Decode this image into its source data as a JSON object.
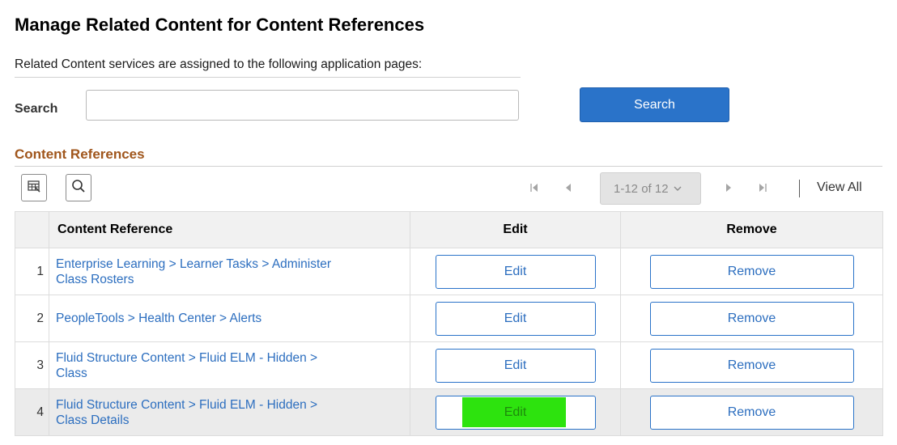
{
  "page": {
    "title": "Manage Related Content for Content References",
    "instruction": "Related Content services are assigned to the following application pages:"
  },
  "search": {
    "label": "Search",
    "value": "",
    "placeholder": "",
    "button_label": "Search"
  },
  "grid": {
    "section_title": "Content References",
    "toolbar": {
      "personalize_icon": "grid-personalize-icon",
      "find_icon": "search-icon"
    },
    "pager": {
      "range_label": "1-12 of 12",
      "view_all_label": "View All"
    },
    "columns": {
      "row_number": "",
      "content_reference": "Content Reference",
      "edit": "Edit",
      "remove": "Remove"
    },
    "rows": [
      {
        "number": "1",
        "content_reference_line1": "Enterprise Learning > Learner Tasks > Administer",
        "content_reference_line2": "Class Rosters",
        "edit_label": "Edit",
        "remove_label": "Remove"
      },
      {
        "number": "2",
        "content_reference_line1": "PeopleTools > Health Center > Alerts",
        "content_reference_line2": "",
        "edit_label": "Edit",
        "remove_label": "Remove"
      },
      {
        "number": "3",
        "content_reference_line1": "Fluid Structure Content > Fluid ELM - Hidden >",
        "content_reference_line2": "Class",
        "edit_label": "Edit",
        "remove_label": "Remove"
      },
      {
        "number": "4",
        "content_reference_line1": "Fluid Structure Content > Fluid ELM - Hidden >",
        "content_reference_line2": "Class Details",
        "edit_label": "Edit",
        "remove_label": "Remove"
      }
    ]
  },
  "colors": {
    "primary_button": "#2a73c9",
    "link": "#2c6ebf",
    "section_title": "#a0561c",
    "highlight": "#2de30e",
    "selected_row": "#ebebeb"
  }
}
